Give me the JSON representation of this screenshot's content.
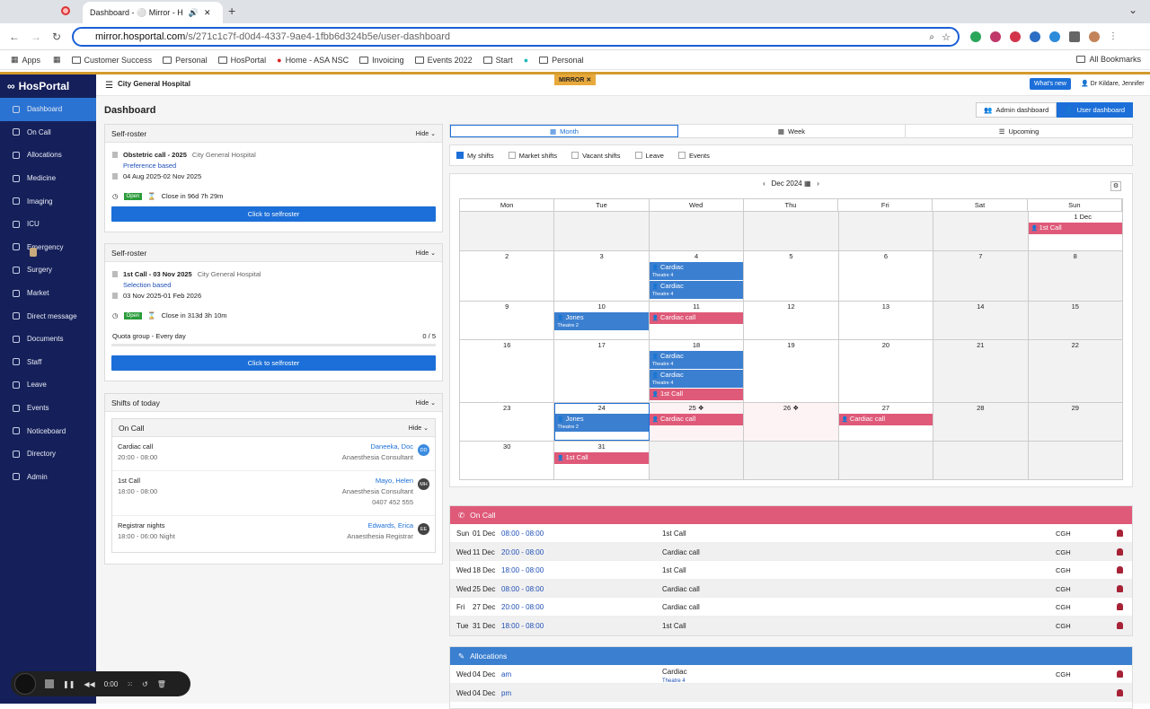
{
  "browser": {
    "tab_title": "Dashboard - ⚪ Mirror - H",
    "url_host": "mirror.hosportal.com",
    "url_path": "/s/271c1c7f-d0d4-4337-9ae4-1fbb6d324b5e/user-dashboard",
    "bookmarks": [
      "Apps",
      "Customer Success",
      "Personal",
      "HosPortal",
      "Home - ASA NSC",
      "Invoicing",
      "Events 2022",
      "Start",
      "Personal"
    ],
    "all_bookmarks": "All Bookmarks"
  },
  "app": {
    "logo": "HosPortal",
    "hospital": "City General Hospital",
    "mirror_badge": "MIRROR ✕",
    "whats_new": "What's new",
    "user": "Dr Kildare, Jennifer",
    "page_title": "Dashboard",
    "admin_dashboard": "Admin dashboard",
    "user_dashboard": "User dashboard"
  },
  "sidebar": {
    "items": [
      {
        "label": "Dashboard",
        "icon": "home-icon"
      },
      {
        "label": "On Call",
        "icon": "phone-icon"
      },
      {
        "label": "Allocations",
        "icon": "allocations-icon"
      },
      {
        "label": "Medicine",
        "icon": "medicine-icon"
      },
      {
        "label": "Imaging",
        "icon": "imaging-icon"
      },
      {
        "label": "ICU",
        "icon": "icu-icon"
      },
      {
        "label": "Emergency",
        "icon": "emergency-icon"
      },
      {
        "label": "Surgery",
        "icon": "surgery-icon"
      },
      {
        "label": "Market",
        "icon": "tag-icon"
      },
      {
        "label": "Direct message",
        "icon": "message-icon"
      },
      {
        "label": "Documents",
        "icon": "document-icon"
      },
      {
        "label": "Staff",
        "icon": "staff-icon"
      },
      {
        "label": "Leave",
        "icon": "leave-icon"
      },
      {
        "label": "Events",
        "icon": "events-icon"
      },
      {
        "label": "Noticeboard",
        "icon": "noticeboard-icon"
      },
      {
        "label": "Directory",
        "icon": "directory-icon"
      },
      {
        "label": "Admin",
        "icon": "gear-icon"
      }
    ]
  },
  "selfroster1": {
    "title": "Self-roster",
    "hide": "Hide",
    "name": "Obstetric call - 2025",
    "hospital": "City General Hospital",
    "basis": "Preference based",
    "dates": "04 Aug 2025-02 Nov 2025",
    "status": "Open",
    "close": "Close in 96d 7h 29m",
    "button": "Click to selfroster"
  },
  "selfroster2": {
    "title": "Self-roster",
    "hide": "Hide",
    "name": "1st Call - 03 Nov 2025",
    "hospital": "City General Hospital",
    "basis": "Selection based",
    "dates": "03 Nov 2025-01 Feb 2026",
    "status": "Open",
    "close": "Close in 313d 3h 10m",
    "quota_label": "Quota group - Every day",
    "quota_value": "0 / 5",
    "button": "Click to selfroster"
  },
  "today": {
    "title": "Shifts of today",
    "hide": "Hide",
    "oncall_title": "On Call",
    "oncall_hide": "Hide",
    "rows": [
      {
        "shift": "Cardiac call",
        "time": "20:00 - 08:00",
        "name": "Daneeka, Doc",
        "role": "Anaesthesia Consultant",
        "phone": "",
        "initials": "DD",
        "color": "#3b8be0"
      },
      {
        "shift": "1st Call",
        "time": "18:00 - 08:00",
        "name": "Mayo, Helen",
        "role": "Anaesthesia Consultant",
        "phone": "0407 452 555",
        "initials": "MH",
        "color": "#444444"
      },
      {
        "shift": "Registrar nights",
        "time": "18:00 - 06:00   Night",
        "name": "Edwards, Erica",
        "role": "Anaesthesia Registrar",
        "phone": "",
        "initials": "EE",
        "color": "#444444"
      }
    ]
  },
  "calendar": {
    "tabs": [
      "Month",
      "Week",
      "Upcoming"
    ],
    "filters": [
      {
        "label": "My shifts",
        "checked": true
      },
      {
        "label": "Market shifts",
        "checked": false
      },
      {
        "label": "Vacant shifts",
        "checked": false
      },
      {
        "label": "Leave",
        "checked": false
      },
      {
        "label": "Events",
        "checked": false
      }
    ],
    "month": "Dec 2024",
    "weekdays": [
      "Mon",
      "Tue",
      "Wed",
      "Thu",
      "Fri",
      "Sat",
      "Sun"
    ],
    "weeks": [
      {
        "h": 44,
        "days": [
          {
            "n": "",
            "shade": true
          },
          {
            "n": "",
            "shade": true
          },
          {
            "n": "",
            "shade": true
          },
          {
            "n": "",
            "shade": true
          },
          {
            "n": "",
            "shade": true
          },
          {
            "n": "",
            "shade": true
          },
          {
            "n": "1 Dec",
            "ev": [
              {
                "c": "pink",
                "t": "1st Call"
              }
            ]
          }
        ]
      },
      {
        "h": 56,
        "days": [
          {
            "n": "2"
          },
          {
            "n": "3"
          },
          {
            "n": "4",
            "ev": [
              {
                "c": "blue",
                "t": "Cardiac",
                "s": "Theatre 4"
              },
              {
                "c": "blue",
                "t": "Cardiac",
                "s": "Theatre 4"
              }
            ]
          },
          {
            "n": "5"
          },
          {
            "n": "6"
          },
          {
            "n": "7",
            "shade": true
          },
          {
            "n": "8",
            "shade": true
          }
        ]
      },
      {
        "h": 43,
        "days": [
          {
            "n": "9"
          },
          {
            "n": "10",
            "ev": [
              {
                "c": "blue",
                "t": "Jones",
                "s": "Theatre 2"
              }
            ]
          },
          {
            "n": "11",
            "ev": [
              {
                "c": "pink",
                "t": "Cardiac call"
              }
            ]
          },
          {
            "n": "12"
          },
          {
            "n": "13"
          },
          {
            "n": "14",
            "shade": true
          },
          {
            "n": "15",
            "shade": true
          }
        ]
      },
      {
        "h": 70,
        "days": [
          {
            "n": "16"
          },
          {
            "n": "17"
          },
          {
            "n": "18",
            "ev": [
              {
                "c": "blue",
                "t": "Cardiac",
                "s": "Theatre 4"
              },
              {
                "c": "blue",
                "t": "Cardiac",
                "s": "Theatre 4"
              },
              {
                "c": "pink",
                "t": "1st Call"
              }
            ]
          },
          {
            "n": "19"
          },
          {
            "n": "20"
          },
          {
            "n": "21",
            "shade": true
          },
          {
            "n": "22",
            "shade": true
          }
        ]
      },
      {
        "h": 43,
        "days": [
          {
            "n": "23"
          },
          {
            "n": "24",
            "today": true,
            "ev": [
              {
                "c": "blue",
                "t": "Jones",
                "s": "Theatre 2"
              }
            ]
          },
          {
            "n": "25 ❖",
            "pink": true,
            "ev": [
              {
                "c": "pink",
                "t": "Cardiac call"
              }
            ]
          },
          {
            "n": "26 ❖",
            "pink": true
          },
          {
            "n": "27",
            "ev": [
              {
                "c": "pink",
                "t": "Cardiac call"
              }
            ]
          },
          {
            "n": "28",
            "shade": true
          },
          {
            "n": "29",
            "shade": true
          }
        ]
      },
      {
        "h": 44,
        "days": [
          {
            "n": "30"
          },
          {
            "n": "31",
            "ev": [
              {
                "c": "pink",
                "t": "1st Call"
              }
            ]
          },
          {
            "n": "",
            "shade": true
          },
          {
            "n": "",
            "shade": true
          },
          {
            "n": "",
            "shade": true
          },
          {
            "n": "",
            "shade": true
          },
          {
            "n": "",
            "shade": true
          }
        ]
      }
    ]
  },
  "oncall_list": {
    "title": "On Call",
    "rows": [
      {
        "day": "Sun",
        "date": "01 Dec",
        "time": "08:00 - 08:00",
        "shift": "1st Call",
        "site": "CGH"
      },
      {
        "day": "Wed",
        "date": "11 Dec",
        "time": "20:00 - 08:00",
        "shift": "Cardiac call",
        "site": "CGH"
      },
      {
        "day": "Wed",
        "date": "18 Dec",
        "time": "18:00 - 08:00",
        "shift": "1st Call",
        "site": "CGH"
      },
      {
        "day": "Wed",
        "date": "25 Dec",
        "time": "08:00 - 08:00",
        "shift": "Cardiac call",
        "site": "CGH"
      },
      {
        "day": "Fri",
        "date": "27 Dec",
        "time": "20:00 - 08:00",
        "shift": "Cardiac call",
        "site": "CGH"
      },
      {
        "day": "Tue",
        "date": "31 Dec",
        "time": "18:00 - 08:00",
        "shift": "1st Call",
        "site": "CGH"
      }
    ]
  },
  "alloc_list": {
    "title": "Allocations",
    "rows": [
      {
        "day": "Wed",
        "date": "04 Dec",
        "time": "am",
        "shift": "Cardiac",
        "sub": "Theatre 4",
        "site": "CGH"
      },
      {
        "day": "Wed",
        "date": "04 Dec",
        "time": "pm",
        "shift": "",
        "sub": "",
        "site": ""
      }
    ]
  },
  "recorder": {
    "time": "0:00"
  },
  "colors": {
    "sidebar": "#15205a",
    "accent": "#1c6fd8",
    "pink": "#df5a79",
    "blue": "#3b7fd0"
  }
}
